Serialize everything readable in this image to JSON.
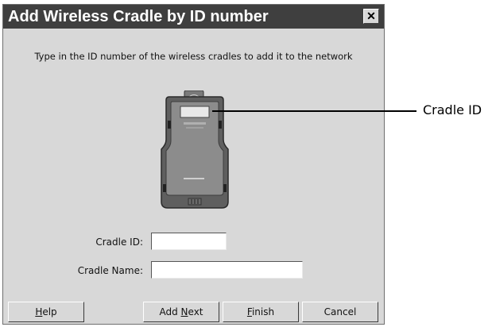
{
  "dialog": {
    "title": "Add Wireless Cradle by ID number",
    "close_glyph": "✕",
    "instruction": "Type in the ID number of the wireless cradles to add it to the network"
  },
  "fields": {
    "cradle_id_label": "Cradle ID:",
    "cradle_id_value": "",
    "cradle_name_label": "Cradle Name:",
    "cradle_name_value": ""
  },
  "buttons": {
    "help": {
      "before": "",
      "accel": "H",
      "after": "elp"
    },
    "add_next": {
      "before": "Add ",
      "accel": "N",
      "after": "ext"
    },
    "finish": {
      "before": "",
      "accel": "F",
      "after": "inish"
    },
    "cancel": {
      "before": "Cancel",
      "accel": "",
      "after": ""
    }
  },
  "callout": {
    "label": "Cradle ID"
  },
  "icons": {
    "close": "close-icon",
    "device": "wireless-cradle-image"
  },
  "colors": {
    "titlebar_bg": "#3f3f3f",
    "dialog_bg": "#d8d8d8"
  }
}
